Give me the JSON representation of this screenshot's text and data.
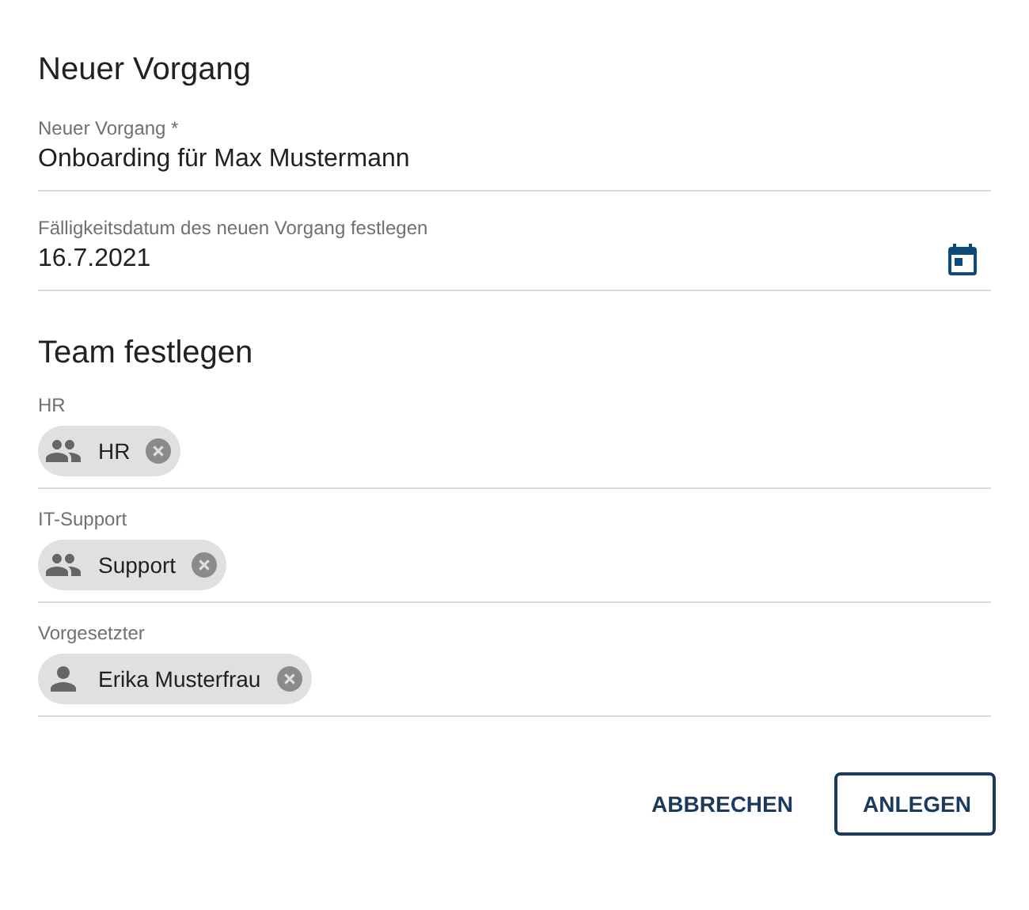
{
  "dialog": {
    "title": "Neuer Vorgang"
  },
  "fields": [
    {
      "label": "Neuer Vorgang *",
      "value": "Onboarding für Max Mustermann",
      "kind": "text"
    },
    {
      "label": "Fälligkeitsdatum des neuen Vorgang festlegen",
      "value": "16.7.2021",
      "kind": "date"
    }
  ],
  "team": {
    "title": "Team festlegen",
    "fields": [
      {
        "label": "HR",
        "chips": [
          {
            "text": "HR",
            "kind": "group"
          }
        ]
      },
      {
        "label": "IT-Support",
        "chips": [
          {
            "text": "Support",
            "kind": "group"
          }
        ]
      },
      {
        "label": "Vorgesetzter",
        "chips": [
          {
            "text": "Erika Musterfrau",
            "kind": "person"
          }
        ]
      }
    ]
  },
  "buttons": [
    {
      "label": "ABBRECHEN",
      "kind": "text"
    },
    {
      "label": "ANLEGEN",
      "kind": "outlined"
    }
  ]
}
